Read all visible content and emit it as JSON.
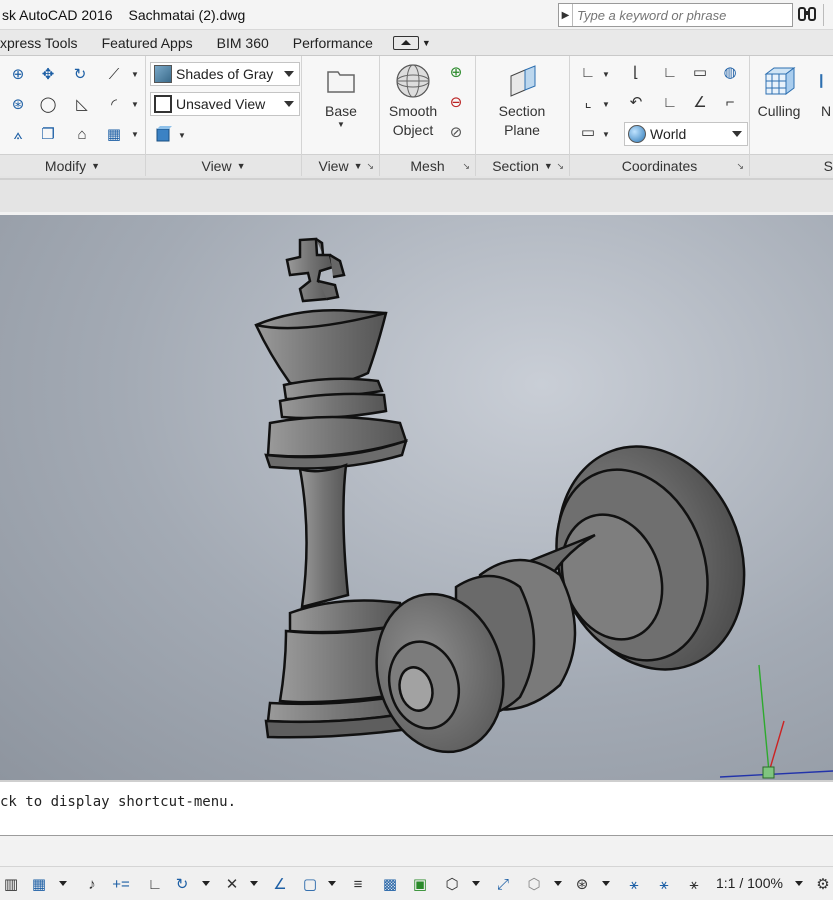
{
  "title_bar": {
    "app_title": "sk AutoCAD 2016",
    "document_title": "Sachmatai (2).dwg",
    "search_placeholder": "Type a keyword or phrase",
    "search_icon": "binoculars-icon"
  },
  "ribbon_tabs": [
    "xpress Tools",
    "Featured Apps",
    "BIM 360",
    "Performance"
  ],
  "ribbon": {
    "panels": [
      {
        "name": "Modify"
      },
      {
        "name": "View"
      },
      {
        "name": "View"
      },
      {
        "name": "Mesh"
      },
      {
        "name": "Section"
      },
      {
        "name": "Coordinates"
      },
      {
        "name": "S"
      }
    ],
    "visual_style": "Shades of Gray",
    "named_view": "Unsaved View",
    "base_button": "Base",
    "smooth_object": [
      "Smooth",
      "Object"
    ],
    "section_plane": [
      "Section",
      "Plane"
    ],
    "ucs_dropdown": "World",
    "culling_button": "Culling",
    "next_partial": "N"
  },
  "command_line": {
    "text": "ck to display shortcut-menu."
  },
  "status_bar": {
    "annotation_scale": "1:1 / 100%"
  },
  "colors": {
    "viewport_bg": "#a9b0ba",
    "model_gray": "#6e6e6e",
    "axis_y": "#2eaa2e",
    "axis_x": "#cc2222",
    "axis_ground": "#2233aa"
  }
}
